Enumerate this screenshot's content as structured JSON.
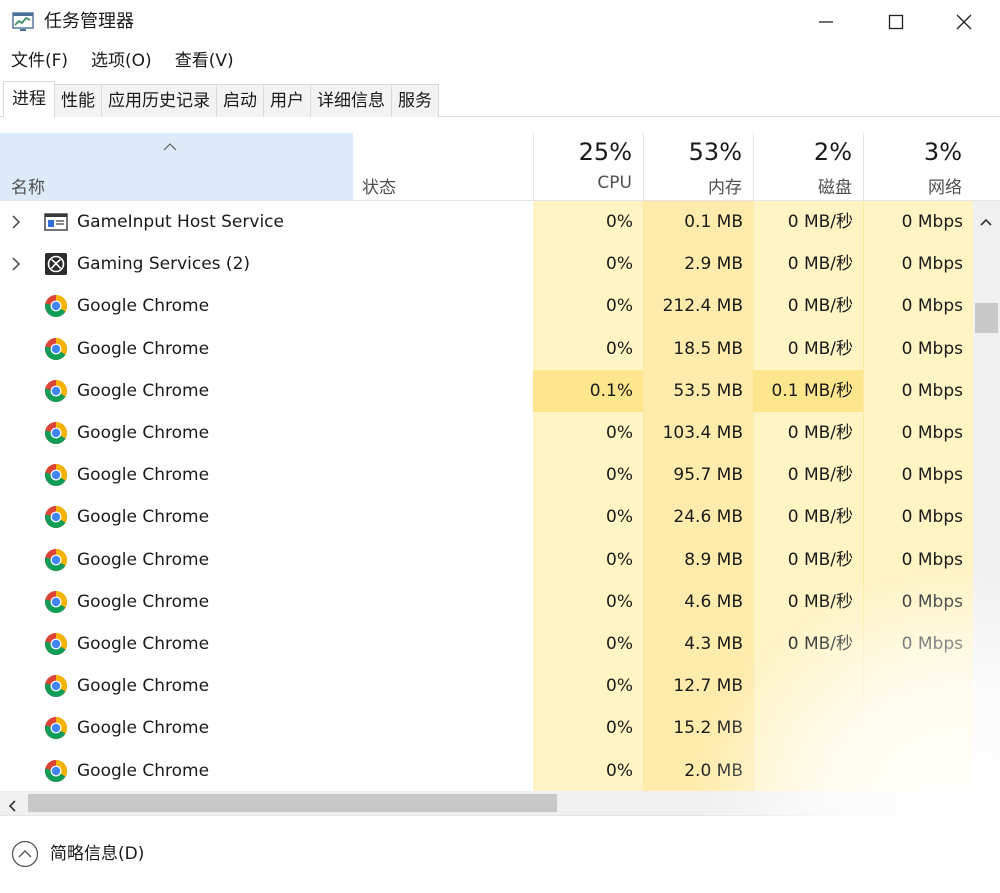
{
  "window": {
    "title": "任务管理器",
    "icon": "task-manager-icon"
  },
  "menu": [
    "文件(F)",
    "选项(O)",
    "查看(V)"
  ],
  "tabs": [
    {
      "label": "进程",
      "active": true
    },
    {
      "label": "性能",
      "active": false
    },
    {
      "label": "应用历史记录",
      "active": false
    },
    {
      "label": "启动",
      "active": false
    },
    {
      "label": "用户",
      "active": false
    },
    {
      "label": "详细信息",
      "active": false
    },
    {
      "label": "服务",
      "active": false
    }
  ],
  "header": {
    "name": "名称",
    "status": "状态",
    "cpu": {
      "percent": "25%",
      "label": "CPU"
    },
    "memory": {
      "percent": "53%",
      "label": "内存"
    },
    "disk": {
      "percent": "2%",
      "label": "磁盘"
    },
    "network": {
      "percent": "3%",
      "label": "网络"
    }
  },
  "rows": [
    {
      "name": "GameInput Host Service",
      "icon": "service-window-icon",
      "expandable": true,
      "cpu": "0%",
      "memory": "0.1 MB",
      "disk": "0 MB/秒",
      "network": "0 Mbps"
    },
    {
      "name": "Gaming Services (2)",
      "icon": "xbox-icon",
      "expandable": true,
      "cpu": "0%",
      "memory": "2.9 MB",
      "disk": "0 MB/秒",
      "network": "0 Mbps"
    },
    {
      "name": "Google Chrome",
      "icon": "chrome-icon",
      "expandable": false,
      "cpu": "0%",
      "memory": "212.4 MB",
      "disk": "0 MB/秒",
      "network": "0 Mbps"
    },
    {
      "name": "Google Chrome",
      "icon": "chrome-icon",
      "expandable": false,
      "cpu": "0%",
      "memory": "18.5 MB",
      "disk": "0 MB/秒",
      "network": "0 Mbps"
    },
    {
      "name": "Google Chrome",
      "icon": "chrome-icon",
      "expandable": false,
      "cpu": "0.1%",
      "memory": "53.5 MB",
      "disk": "0.1 MB/秒",
      "network": "0 Mbps",
      "highlight": true
    },
    {
      "name": "Google Chrome",
      "icon": "chrome-icon",
      "expandable": false,
      "cpu": "0%",
      "memory": "103.4 MB",
      "disk": "0 MB/秒",
      "network": "0 Mbps"
    },
    {
      "name": "Google Chrome",
      "icon": "chrome-icon",
      "expandable": false,
      "cpu": "0%",
      "memory": "95.7 MB",
      "disk": "0 MB/秒",
      "network": "0 Mbps"
    },
    {
      "name": "Google Chrome",
      "icon": "chrome-icon",
      "expandable": false,
      "cpu": "0%",
      "memory": "24.6 MB",
      "disk": "0 MB/秒",
      "network": "0 Mbps"
    },
    {
      "name": "Google Chrome",
      "icon": "chrome-icon",
      "expandable": false,
      "cpu": "0%",
      "memory": "8.9 MB",
      "disk": "0 MB/秒",
      "network": "0 Mbps"
    },
    {
      "name": "Google Chrome",
      "icon": "chrome-icon",
      "expandable": false,
      "cpu": "0%",
      "memory": "4.6 MB",
      "disk": "0 MB/秒",
      "network": "0 Mbps"
    },
    {
      "name": "Google Chrome",
      "icon": "chrome-icon",
      "expandable": false,
      "cpu": "0%",
      "memory": "4.3 MB",
      "disk": "0 MB/秒",
      "network": "0 Mbps"
    },
    {
      "name": "Google Chrome",
      "icon": "chrome-icon",
      "expandable": false,
      "cpu": "0%",
      "memory": "12.7 MB",
      "disk": "",
      "network": ""
    },
    {
      "name": "Google Chrome",
      "icon": "chrome-icon",
      "expandable": false,
      "cpu": "0%",
      "memory": "15.2 MB",
      "disk": "",
      "network": ""
    },
    {
      "name": "Google Chrome",
      "icon": "chrome-icon",
      "expandable": false,
      "cpu": "0%",
      "memory": "2.0 MB",
      "disk": "",
      "network": ""
    }
  ],
  "footer": {
    "toggle_label": "简略信息(D)"
  },
  "colors": {
    "cpu_bg": "#fff4c4",
    "memory_bg": "#ffecac",
    "highlight_bg": "#fde68e",
    "sort_header_bg": "#dcebf7"
  }
}
